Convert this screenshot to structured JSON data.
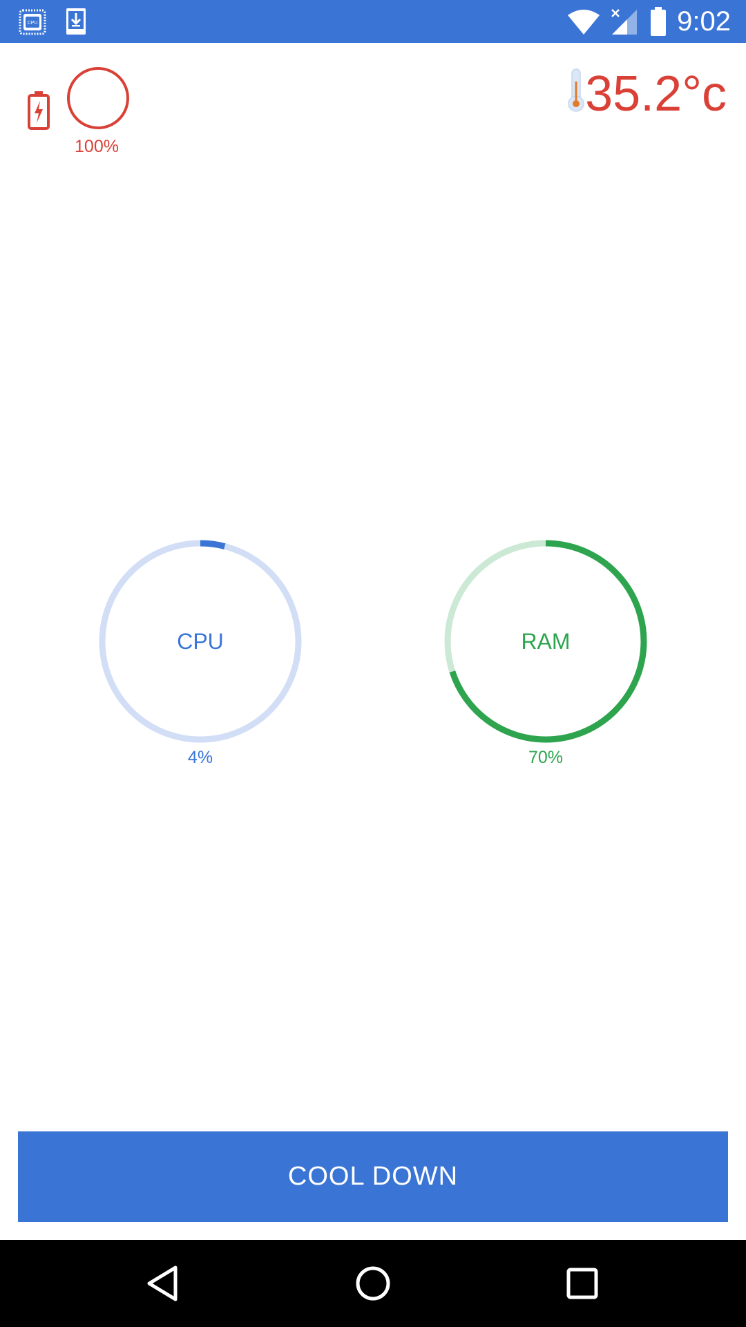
{
  "status_bar": {
    "time": "9:02",
    "icons": [
      "cpu-chip-icon",
      "download-icon",
      "wifi-icon",
      "cell-signal-icon",
      "battery-full-icon"
    ],
    "background": "#3a75d6"
  },
  "battery": {
    "level_label": "100%",
    "level": 100,
    "color": "#d94137",
    "icon": "battery-charging-icon"
  },
  "temperature": {
    "value": "35.2°c",
    "color": "#d94137",
    "icon": "thermometer-icon"
  },
  "gauges": {
    "cpu": {
      "label": "CPU",
      "percent_label": "4%",
      "percent": 4,
      "color": "#3a75d6",
      "track_color": "#d2def6"
    },
    "ram": {
      "label": "RAM",
      "percent_label": "70%",
      "percent": 70,
      "color": "#2ea44f",
      "track_color": "#cbe9d4"
    }
  },
  "actions": {
    "cool_down_label": "COOL DOWN",
    "color": "#3a75d6"
  },
  "nav_bar": {
    "icons": [
      "back-icon",
      "home-icon",
      "recents-icon"
    ]
  }
}
